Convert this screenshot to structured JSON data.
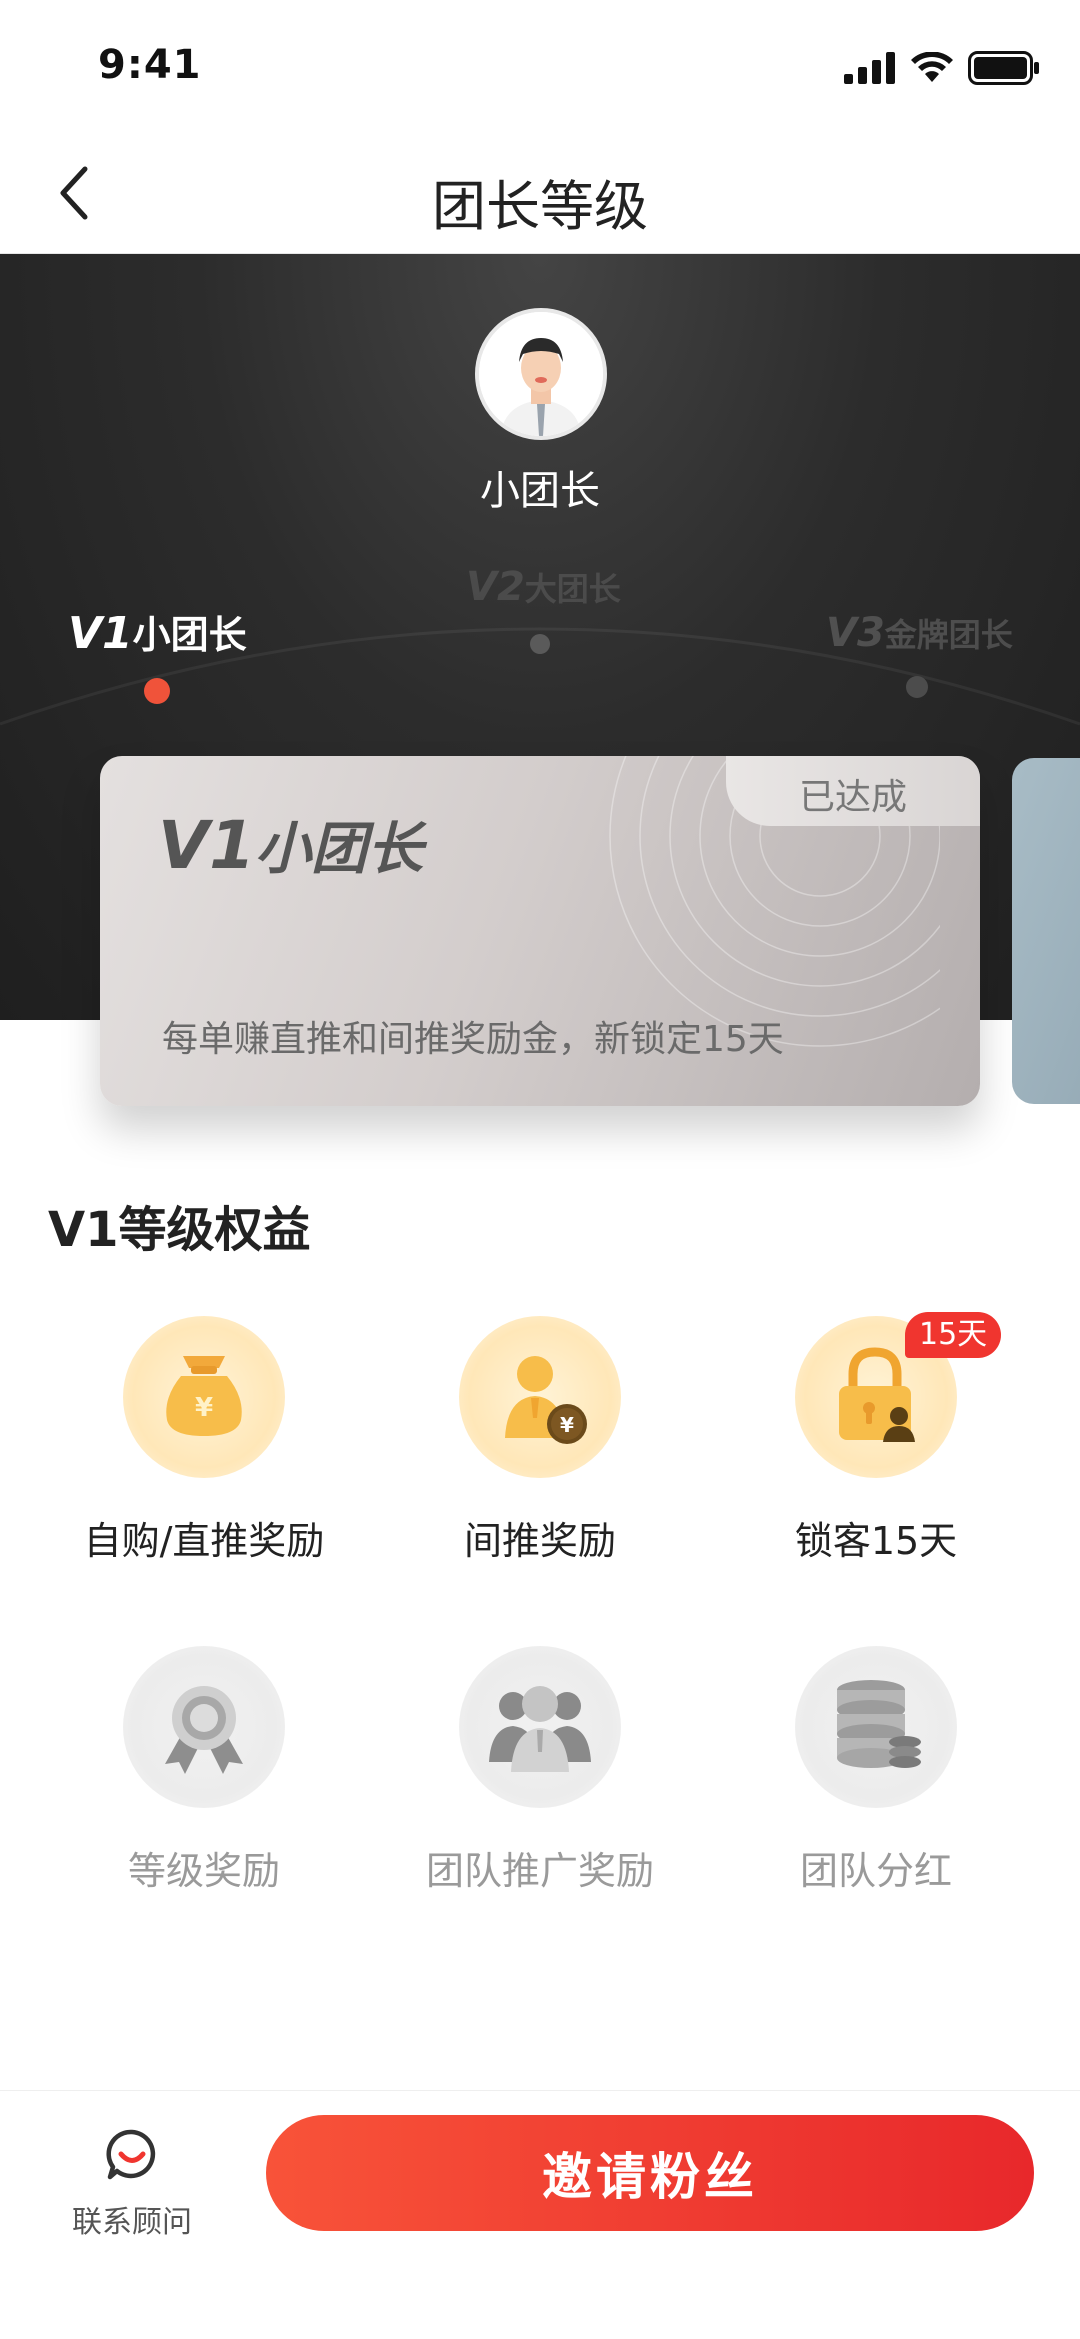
{
  "status_bar": {
    "time": "9:41"
  },
  "nav": {
    "title": "团长等级"
  },
  "profile": {
    "name": "小团长"
  },
  "levels": [
    {
      "code": "V1",
      "name": "小团长",
      "active": true
    },
    {
      "code": "V2",
      "name": "大团长",
      "active": false
    },
    {
      "code": "V3",
      "name": "金牌团长",
      "active": false
    }
  ],
  "card": {
    "code": "V1",
    "name": "小团长",
    "status": "已达成",
    "description": "每单赚直推和间推奖励金，新锁定15天"
  },
  "benefits": {
    "title": "V1等级权益",
    "items": [
      {
        "label": "自购/直推奖励",
        "icon": "money-bag-icon",
        "enabled": true
      },
      {
        "label": "间推奖励",
        "icon": "person-coin-icon",
        "enabled": true
      },
      {
        "label": "锁客15天",
        "icon": "lock-user-icon",
        "enabled": true,
        "tag": "15天"
      },
      {
        "label": "等级奖励",
        "icon": "medal-icon",
        "enabled": false
      },
      {
        "label": "团队推广奖励",
        "icon": "team-icon",
        "enabled": false
      },
      {
        "label": "团队分红",
        "icon": "database-coins-icon",
        "enabled": false
      }
    ]
  },
  "bottom": {
    "contact_label": "联系顾问",
    "invite_label": "邀请粉丝"
  },
  "colors": {
    "accent": "#f0533a",
    "button_start": "#f85339",
    "button_end": "#e8282b",
    "gold": "#f6b93b"
  }
}
